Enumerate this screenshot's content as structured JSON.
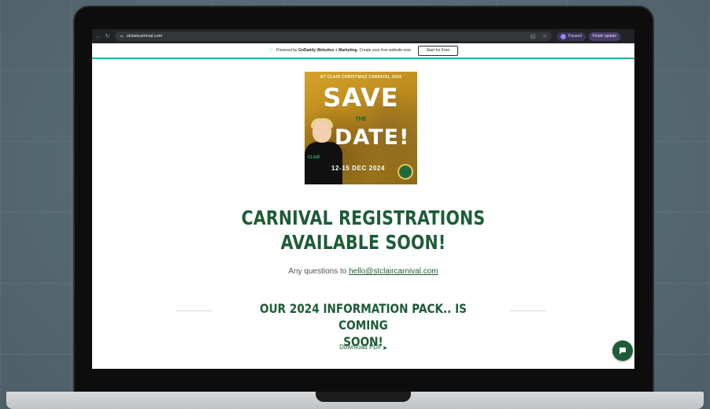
{
  "browser": {
    "url": "stclaircarnival.com",
    "profile_initial": "I",
    "profile_status": "Paused",
    "update_label": "Finish update"
  },
  "banner": {
    "prefix": "Powered by ",
    "brand": "GoDaddy Websites + Marketing",
    "suffix": ". Create your free website now.",
    "button": "Start for Free"
  },
  "hero": {
    "kicker": "ST CLAIR CHRISTMAS CARNIVAL 2024",
    "save": "SAVE",
    "the": "THE",
    "date": "DATE!",
    "dates": "12-15 DEC 2024",
    "shirt_logo": "CLAIR"
  },
  "main": {
    "heading_line1": "CARNIVAL REGISTRATIONS",
    "heading_line2": "AVAILABLE SOON!",
    "questions_prefix": "Any questions to ",
    "email": "hello@stclaircarnival.com",
    "pack_line1": "OUR 2024 INFORMATION PACK.. IS COMING",
    "pack_line2": "SOON!",
    "download": "Download PDF"
  },
  "colors": {
    "brand_green": "#1d5c37",
    "banner_accent": "#1fb3a5",
    "hero_gold": "#c9961f"
  },
  "icons": {
    "back": "arrow-left-icon",
    "reload": "reload-icon",
    "site_settings": "tune-icon",
    "cast": "cast-icon",
    "bookmark": "star-icon",
    "chat": "chat-icon",
    "download_caret": "triangle-right-icon"
  }
}
